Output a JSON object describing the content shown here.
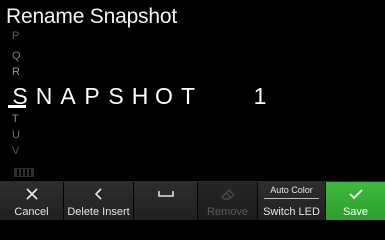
{
  "screen": {
    "title": "Rename Snapshot"
  },
  "alphabet_wheel": {
    "above": [
      "P",
      "Q",
      "R"
    ],
    "below": [
      "T",
      "U",
      "V"
    ]
  },
  "name_field": {
    "characters": [
      "S",
      "N",
      "A",
      "P",
      "S",
      "H",
      "O",
      "T",
      " ",
      " ",
      "1"
    ],
    "cursor_index": 0
  },
  "icons": {
    "cancel": "x-icon",
    "delete": "chevron-left-icon",
    "insert_space": "space-bracket-icon",
    "remove": "eraser-icon",
    "save": "checkmark-icon",
    "keyboard": "keyboard-icon"
  },
  "buttons": {
    "cancel": {
      "label": "Cancel"
    },
    "delete": {
      "label": "Delete"
    },
    "insert": {
      "label": "Insert"
    },
    "remove": {
      "label": "Remove"
    },
    "switch_led": {
      "top_label": "Auto Color",
      "label": "Switch LED"
    },
    "save": {
      "label": "Save"
    }
  },
  "colors": {
    "background": "#000000",
    "save_accent": "#35ad35",
    "button_bg": "#272727",
    "disabled_text": "#5b5b5b"
  }
}
